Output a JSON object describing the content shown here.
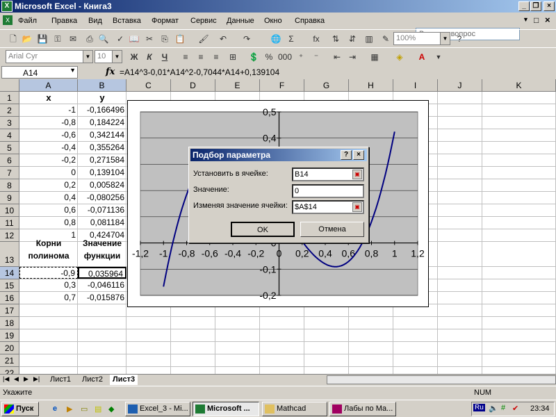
{
  "window": {
    "title": "Microsoft Excel - Книга3"
  },
  "menu": {
    "items": [
      "Файл",
      "Правка",
      "Вид",
      "Вставка",
      "Формат",
      "Сервис",
      "Данные",
      "Окно",
      "Справка"
    ],
    "help_placeholder": "Введите вопрос"
  },
  "toolbar": {
    "zoom": "100%",
    "font": "Arial Cyr",
    "size": "10",
    "bold": "Ж",
    "italic": "К",
    "underline": "Ч"
  },
  "formula_bar": {
    "cell_ref": "A14",
    "fx": "fx",
    "formula": "=A14^3-0,01*A14^2-0,7044*A14+0,139104"
  },
  "columns": [
    "A",
    "B",
    "C",
    "D",
    "E",
    "F",
    "G",
    "H",
    "I",
    "J",
    "K"
  ],
  "rows": [
    "1",
    "2",
    "3",
    "4",
    "5",
    "6",
    "7",
    "8",
    "9",
    "10",
    "11",
    "12",
    "13",
    "14",
    "15",
    "16",
    "17",
    "18",
    "19",
    "20",
    "21",
    "22",
    "23"
  ],
  "table": {
    "header_x": "x",
    "header_y": "y",
    "rows": [
      [
        "-1",
        "-0,166496"
      ],
      [
        "-0,8",
        "0,184224"
      ],
      [
        "-0,6",
        "0,342144"
      ],
      [
        "-0,4",
        "0,355264"
      ],
      [
        "-0,2",
        "0,271584"
      ],
      [
        "0",
        "0,139104"
      ],
      [
        "0,2",
        "0,005824"
      ],
      [
        "0,4",
        "-0,080256"
      ],
      [
        "0,6",
        "-0,071136"
      ],
      [
        "0,8",
        "0,081184"
      ],
      [
        "1",
        "0,424704"
      ]
    ],
    "roots_header_1": "Корни",
    "roots_header_2": "полинома",
    "values_header_1": "Значение",
    "values_header_2": "функции",
    "roots": [
      [
        "-0,9",
        "0,035964"
      ],
      [
        "0,3",
        "-0,046116"
      ],
      [
        "0,7",
        "-0,015876"
      ]
    ]
  },
  "chart_data": {
    "type": "line",
    "x": [
      -1,
      -0.8,
      -0.6,
      -0.4,
      -0.2,
      0,
      0.2,
      0.4,
      0.6,
      0.8,
      1
    ],
    "series": [
      {
        "values": [
          -0.166496,
          0.184224,
          0.342144,
          0.355264,
          0.271584,
          0.139104,
          0.005824,
          -0.080256,
          -0.071136,
          0.081184,
          0.424704
        ]
      }
    ],
    "xlim": [
      -1.2,
      1.2
    ],
    "ylim": [
      -0.2,
      0.5
    ],
    "x_ticks": [
      "-1,2",
      "-1",
      "-0,8",
      "-0,6",
      "-0,4",
      "-0,2",
      "0",
      "0,2",
      "0,4",
      "0,6",
      "0,8",
      "1",
      "1,2"
    ],
    "y_ticks": [
      "0,5",
      "0,4",
      "0,3",
      "0,2",
      "0,1",
      "0",
      "-0,1",
      "-0,2"
    ],
    "line_color": "#000080",
    "plot_bg": "#c0c0c0"
  },
  "dialog": {
    "title": "Подбор параметра",
    "label_set_cell": "Установить в ячейке:",
    "value_set_cell": "B14",
    "label_value": "Значение:",
    "value_value": "0",
    "label_changing": "Изменяя значение ячейки:",
    "value_changing": "$A$14",
    "ok": "OK",
    "cancel": "Отмена"
  },
  "sheet_tabs": [
    "Лист1",
    "Лист2",
    "Лист3"
  ],
  "status": {
    "left": "Укажите",
    "num": "NUM"
  },
  "taskbar": {
    "start": "Пуск",
    "tasks": [
      "Excel_3 - Mi...",
      "Microsoft ...",
      "Mathcad",
      "Лабы по Ма..."
    ],
    "lang": "Ru",
    "time": "23:34"
  }
}
